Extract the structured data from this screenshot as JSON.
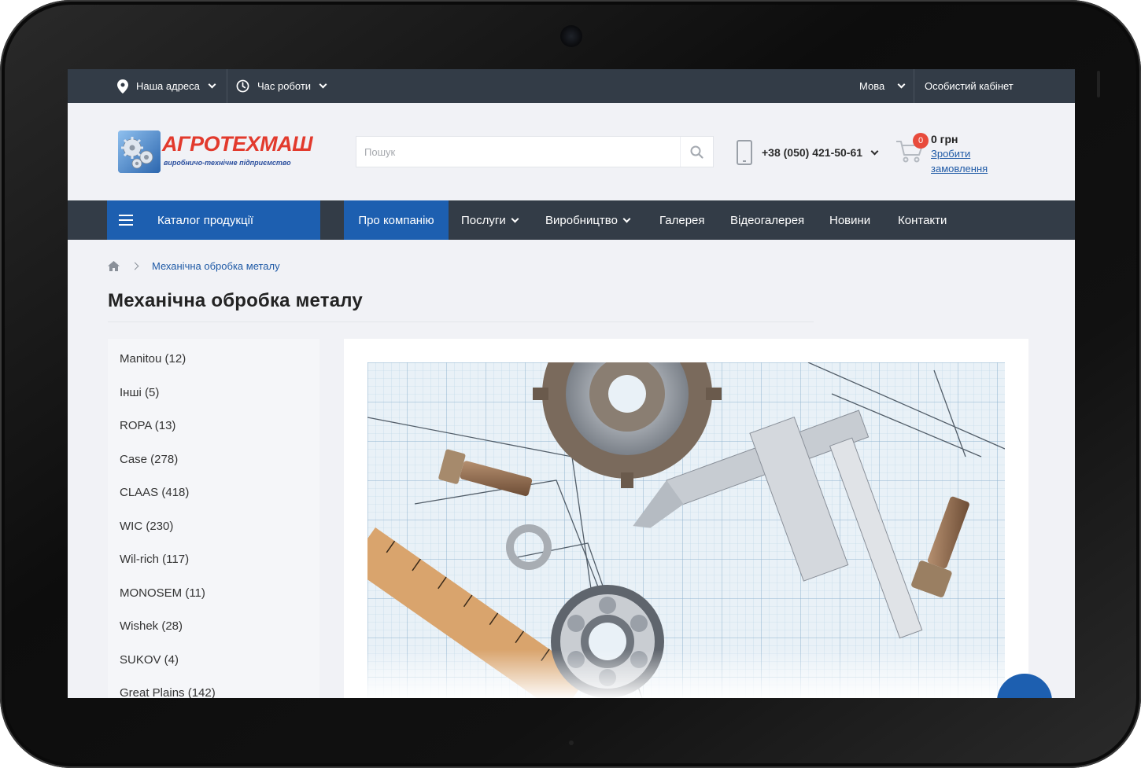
{
  "topbar": {
    "address_label": "Наша адреса",
    "hours_label": "Час роботи",
    "language_label": "Мова",
    "account_label": "Особистий кабінет"
  },
  "header": {
    "logo_text": "АГРОТЕХМАШ",
    "logo_subtitle": "виробничо-технічне підприємство",
    "search_placeholder": "Пошук",
    "phone": "+38 (050) 421-50-61",
    "cart_count": "0",
    "cart_total": "0 грн",
    "cart_link": "Зробити замовлення"
  },
  "nav": {
    "catalog_label": "Каталог продукції",
    "items": [
      {
        "label": "Про компанію"
      },
      {
        "label": "Послуги"
      },
      {
        "label": "Виробництво"
      },
      {
        "label": "Галерея"
      },
      {
        "label": "Відеогалерея"
      },
      {
        "label": "Новини"
      },
      {
        "label": "Контакти"
      }
    ]
  },
  "breadcrumb": {
    "current": "Механічна обробка металу"
  },
  "page_title": "Механічна обробка металу",
  "sidebar": {
    "items": [
      {
        "label": "Manitou (12)"
      },
      {
        "label": "Інші (5)"
      },
      {
        "label": "ROPA (13)"
      },
      {
        "label": "Case (278)"
      },
      {
        "label": "CLAAS (418)"
      },
      {
        "label": "WIC (230)"
      },
      {
        "label": "Wil-rich (117)"
      },
      {
        "label": "MONOSEM (11)"
      },
      {
        "label": "Wishek (28)"
      },
      {
        "label": "SUKOV (4)"
      },
      {
        "label": "Great Plains (142)"
      }
    ]
  },
  "colors": {
    "dark_bar": "#333c47",
    "accent_blue": "#1d5fb0",
    "cart_badge": "#e84b3c",
    "logo_red": "#e23a2d"
  },
  "icons": {
    "address": "location-pin-icon",
    "hours": "clock-icon",
    "search": "search-icon",
    "phone": "phone-icon",
    "cart": "cart-icon",
    "menu": "hamburger-menu-icon",
    "home": "home-icon"
  }
}
